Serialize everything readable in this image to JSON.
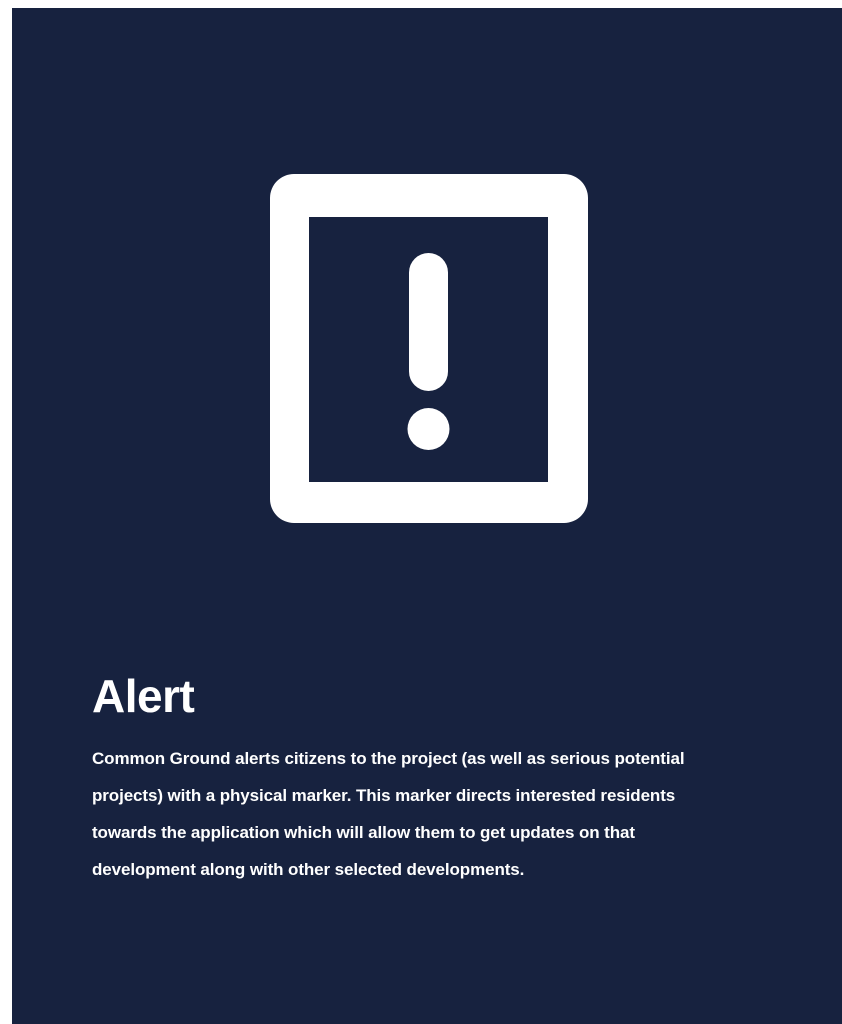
{
  "colors": {
    "background": "#17223f",
    "foreground": "#ffffff"
  },
  "icon": {
    "name": "alert-exclamation-icon"
  },
  "section": {
    "title": "Alert",
    "description": "Common Ground alerts citizens to the project (as well as serious potential projects) with a physical marker. This marker directs interested residents towards the application which will allow them to get updates on that development along with other selected developments."
  }
}
